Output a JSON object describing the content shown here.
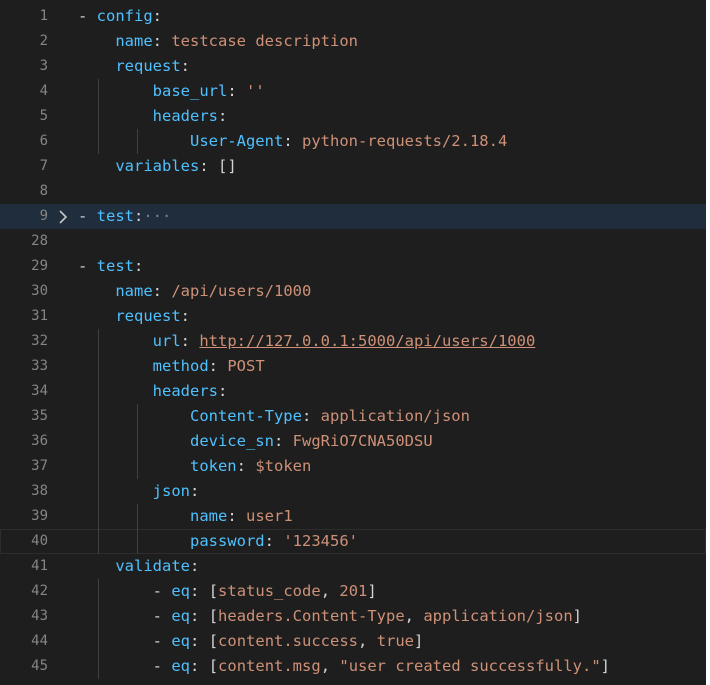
{
  "editor": {
    "lines": [
      {
        "num": "1",
        "text": "- config:"
      },
      {
        "num": "2",
        "text": "    name: testcase description"
      },
      {
        "num": "3",
        "text": "    request:"
      },
      {
        "num": "4",
        "text": "        base_url: ''"
      },
      {
        "num": "5",
        "text": "        headers:"
      },
      {
        "num": "6",
        "text": "            User-Agent: python-requests/2.18.4"
      },
      {
        "num": "7",
        "text": "    variables: []"
      },
      {
        "num": "8",
        "text": ""
      },
      {
        "num": "9",
        "text": "- test:···",
        "folded": true
      },
      {
        "num": "28",
        "text": ""
      },
      {
        "num": "29",
        "text": "- test:"
      },
      {
        "num": "30",
        "text": "    name: /api/users/1000"
      },
      {
        "num": "31",
        "text": "    request:"
      },
      {
        "num": "32",
        "text": "        url: http://127.0.0.1:5000/api/users/1000"
      },
      {
        "num": "33",
        "text": "        method: POST"
      },
      {
        "num": "34",
        "text": "        headers:"
      },
      {
        "num": "35",
        "text": "            Content-Type: application/json"
      },
      {
        "num": "36",
        "text": "            device_sn: FwgRiO7CNA50DSU"
      },
      {
        "num": "37",
        "text": "            token: $token"
      },
      {
        "num": "38",
        "text": "        json:"
      },
      {
        "num": "39",
        "text": "            name: user1"
      },
      {
        "num": "40",
        "text": "            password: '123456'"
      },
      {
        "num": "41",
        "text": "    validate:"
      },
      {
        "num": "42",
        "text": "        - eq: [status_code, 201]"
      },
      {
        "num": "43",
        "text": "        - eq: [headers.Content-Type, application/json]"
      },
      {
        "num": "44",
        "text": "        - eq: [content.success, true]"
      },
      {
        "num": "45",
        "text": "        - eq: [content.msg, \"user created successfully.\"]"
      }
    ]
  },
  "colors": {
    "background": "#1e1e1e",
    "key": "#4fc1ff",
    "value": "#ce9178",
    "punctuation": "#d4d4d4",
    "line_number": "#858585",
    "folded_highlight": "#1f2d3d"
  },
  "icons": {
    "fold_marker": "chevron-right-icon"
  }
}
